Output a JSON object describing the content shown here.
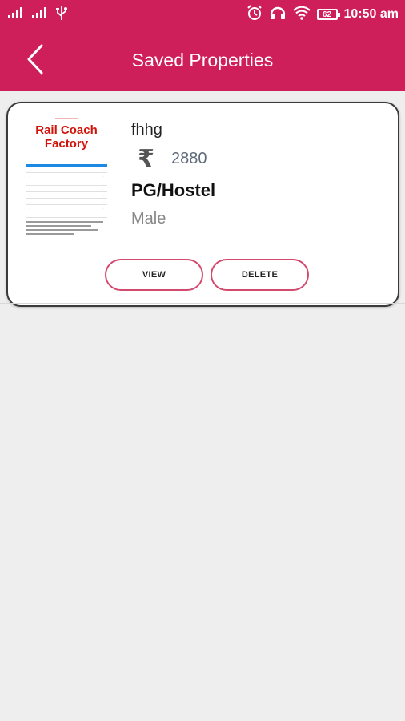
{
  "status_bar": {
    "time": "10:50 am",
    "battery": "62",
    "icons": [
      "signal-icon",
      "signal-icon",
      "usb-icon",
      "alarm-icon",
      "headset-icon",
      "wifi-icon",
      "battery-icon"
    ]
  },
  "app_bar": {
    "title": "Saved Properties",
    "back_icon": "chevron-left-icon"
  },
  "saved_items": [
    {
      "name": "fhhg",
      "currency_symbol": "₹",
      "price": "2880",
      "type": "PG/Hostel",
      "gender": "Male",
      "thumbnail": {
        "title_line1": "Rail Coach",
        "title_line2": "Factory"
      },
      "view_label": "VIEW",
      "delete_label": "DELETE"
    }
  ],
  "colors": {
    "primary": "#cf1f5a",
    "button_border": "#d44a6e",
    "background": "#eeeeee"
  }
}
